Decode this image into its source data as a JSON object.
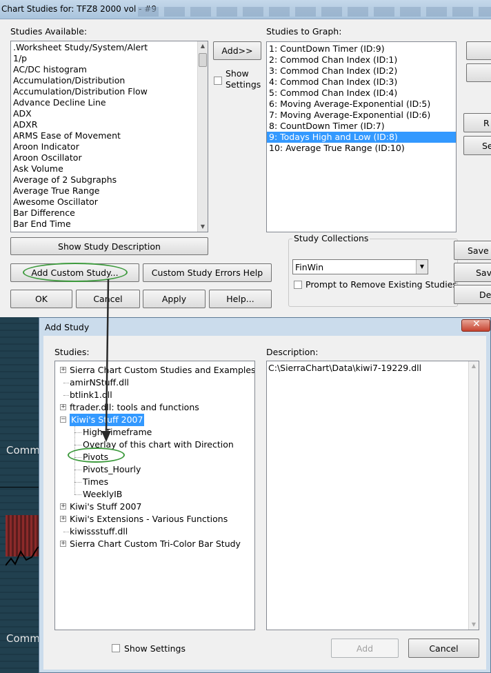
{
  "main_dialog": {
    "title": "Chart Studies for: TFZ8  2000 vol - #9",
    "studies_available_label": "Studies Available:",
    "studies_available": [
      ".Worksheet Study/System/Alert",
      "1/p",
      "AC/DC histogram",
      "Accumulation/Distribution",
      "Accumulation/Distribution Flow",
      "Advance Decline Line",
      "ADX",
      "ADXR",
      "ARMS Ease of Movement",
      "Aroon Indicator",
      "Aroon Oscillator",
      "Ask Volume",
      "Average of 2 Subgraphs",
      "Average True Range",
      "Awesome Oscillator",
      "Bar Difference",
      "Bar End Time"
    ],
    "add_button": "Add>>",
    "show_settings": "Show Settings",
    "studies_to_graph_label": "Studies to Graph:",
    "studies_to_graph": [
      "1: CountDown Timer (ID:9)",
      "2: Commod Chan Index (ID:1)",
      "3: Commod Chan Index (ID:2)",
      "4: Commod Chan Index (ID:3)",
      "5: Commod Chan Index (ID:4)",
      "6: Moving Average-Exponential (ID:5)",
      "7: Moving Average-Exponential (ID:6)",
      "8: CountDown Timer (ID:7)",
      "9: Todays High and Low (ID:8)",
      "10: Average True Range (ID:10)"
    ],
    "selected_graph_index": 8,
    "show_study_description": "Show Study Description",
    "add_custom_study": "Add Custom Study...",
    "custom_study_errors_help": "Custom Study Errors Help",
    "ok": "OK",
    "cancel": "Cancel",
    "apply": "Apply",
    "help": "Help...",
    "study_collections_label": "Study Collections",
    "collection_value": "FinWin",
    "prompt_remove": "Prompt to Remove Existing Studies",
    "right_buttons": [
      "Save",
      "Sav",
      "De"
    ],
    "side_buttons_partial": [
      "R",
      "Se"
    ]
  },
  "background_chart": {
    "labels": [
      "Comm",
      "Comm"
    ]
  },
  "add_study_dialog": {
    "title": "Add Study",
    "close": "x",
    "studies_label": "Studies:",
    "description_label": "Description:",
    "description_value": "C:\\SierraChart\\Data\\kiwi7-19229.dll",
    "tree": [
      {
        "label": "Sierra Chart Custom Studies and Examples",
        "level": 0,
        "expander": true
      },
      {
        "label": "amirNStuff.dll",
        "level": 0,
        "expander": false
      },
      {
        "label": "btlink1.dll",
        "level": 0,
        "expander": false
      },
      {
        "label": "ftrader.dll: tools and functions",
        "level": 0,
        "expander": true
      },
      {
        "label": "Kiwi's Stuff 2007",
        "level": 0,
        "expander": true,
        "expanded": true,
        "selected": true
      },
      {
        "label": "High Timeframe",
        "level": 1
      },
      {
        "label": "Overlay of this chart with Direction",
        "level": 1
      },
      {
        "label": "Pivots",
        "level": 1
      },
      {
        "label": "Pivots_Hourly",
        "level": 1
      },
      {
        "label": "Times",
        "level": 1
      },
      {
        "label": "WeeklyIB",
        "level": 1
      },
      {
        "label": "Kiwi's Stuff 2007",
        "level": 0,
        "expander": true
      },
      {
        "label": "Kiwi's Extensions - Various Functions",
        "level": 0,
        "expander": true
      },
      {
        "label": "kiwissstuff.dll",
        "level": 0,
        "expander": false
      },
      {
        "label": "Sierra Chart Custom Tri-Color Bar Study",
        "level": 0,
        "expander": true
      }
    ],
    "show_settings": "Show Settings",
    "add": "Add",
    "cancel": "Cancel"
  }
}
